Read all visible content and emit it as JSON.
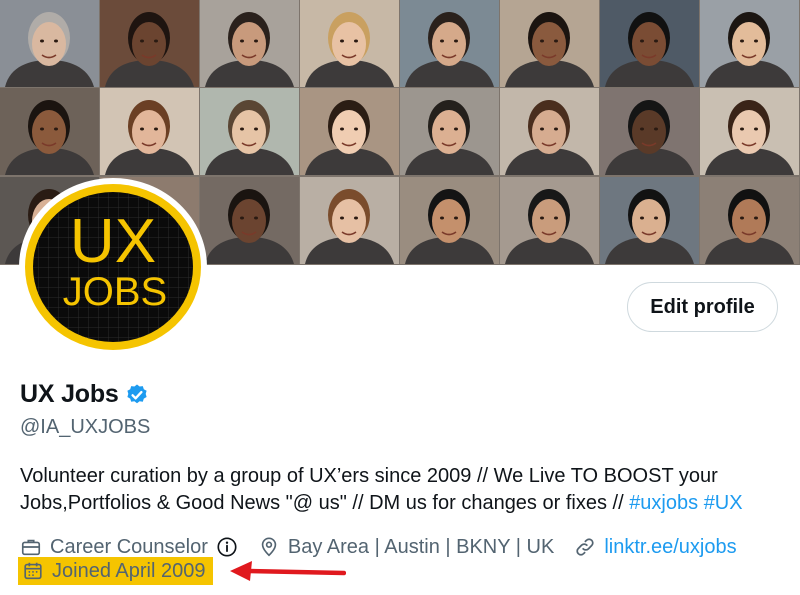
{
  "profile": {
    "name": "UX Jobs",
    "handle": "@IA_UXJOBS",
    "avatar_text_top": "UX",
    "avatar_text_bottom": "JOBS",
    "bio_text": "Volunteer curation by a group of UX’ers since 2009 // We Live TO BOOST your Jobs,Portfolios & Good News \"@ us\" // DM us for changes or fixes //",
    "bio_tags": [
      "#uxjobs",
      "#UX"
    ],
    "category": "Career Counselor",
    "location": "Bay Area | Austin | BKNY | UK",
    "link": "linktr.ee/uxjobs",
    "joined": "Joined April 2009"
  },
  "actions": {
    "edit_profile_label": "Edit profile"
  },
  "colors": {
    "accent": "#1d9bf0",
    "highlight": "#f5c400",
    "annotation_arrow": "#e0191e",
    "avatar_ring": "#f5c400"
  },
  "icons": {
    "verified": "verified-badge-icon",
    "category": "briefcase-icon",
    "info": "info-icon",
    "location": "location-pin-icon",
    "link": "link-icon",
    "joined": "calendar-icon"
  }
}
